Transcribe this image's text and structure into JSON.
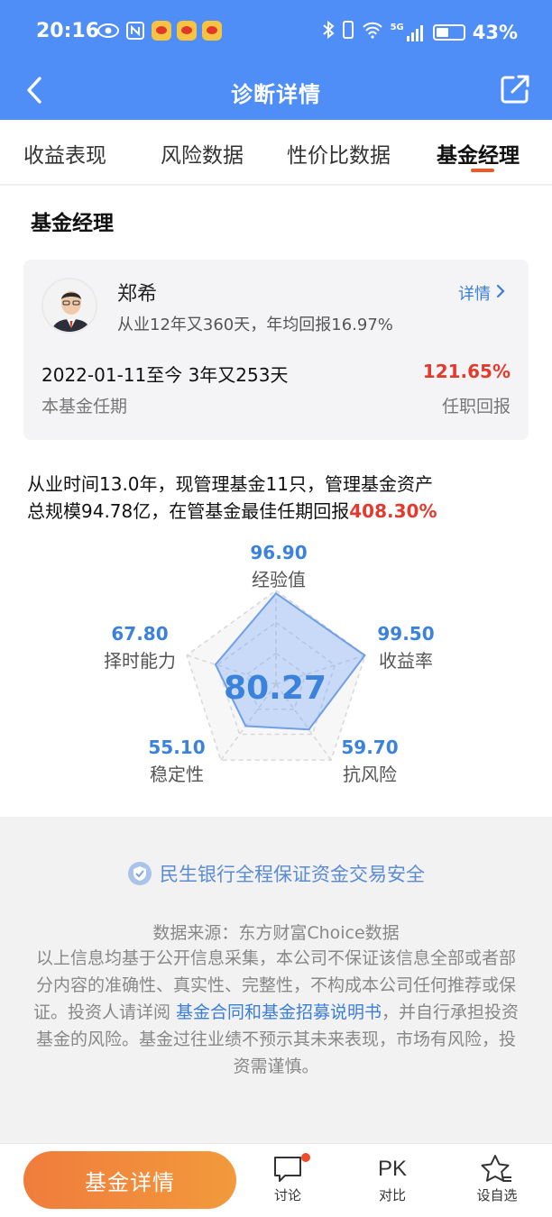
{
  "status_bar": {
    "time": "20:16",
    "network": "5G",
    "battery": "43%"
  },
  "header": {
    "title": "诊断详情"
  },
  "tabs": [
    {
      "label": "收益表现"
    },
    {
      "label": "风险数据"
    },
    {
      "label": "性价比数据"
    },
    {
      "label": "基金经理"
    }
  ],
  "section": {
    "title": "基金经理"
  },
  "manager": {
    "name": "郑希",
    "subtitle": "从业12年又360天，年均回报16.97%",
    "detail_link": "详情",
    "tenure": "2022-01-11至今 3年又253天",
    "tenure_label": "本基金任期",
    "return": "121.65%",
    "return_label": "任职回报"
  },
  "summary": {
    "line1": "从业时间13.0年，现管理基金11只，管理基金资产",
    "line2_prefix": "总规模94.78亿，在管基金最佳任期回报",
    "line2_highlight": "408.30%"
  },
  "radar": {
    "score": "80.27",
    "dimensions": [
      {
        "label": "经验值",
        "value": "96.90",
        "score": 96.9
      },
      {
        "label": "收益率",
        "value": "99.50",
        "score": 99.5
      },
      {
        "label": "抗风险",
        "value": "59.70",
        "score": 59.7
      },
      {
        "label": "稳定性",
        "value": "55.10",
        "score": 55.1
      },
      {
        "label": "择时能力",
        "value": "67.80",
        "score": 67.8
      }
    ]
  },
  "footer": {
    "guarantee": "民生银行全程保证资金交易安全",
    "source": "数据来源：东方财富Choice数据",
    "disclaimer_part1": "以上信息均基于公开信息采集，本公司不保证该信息全部或者部分内容的准确性、真实性、完整性，不构成本公司任何推荐或保证。投资人请详阅 ",
    "disclaimer_link": "基金合同和基金招募说明书",
    "disclaimer_part2": "，并自行承担投资基金的风险。基金过往业绩不预示其未来表现，市场有风险，投资需谨慎。"
  },
  "bottom_bar": {
    "primary_button": "基金详情",
    "nav": [
      {
        "label": "讨论",
        "icon": "chat-icon"
      },
      {
        "label": "对比",
        "icon": "pk-icon",
        "glyph": "PK"
      },
      {
        "label": "设自选",
        "icon": "star-list-icon"
      }
    ]
  },
  "colors": {
    "header_blue": "#4f8ef7",
    "accent_orange": "#f05a2a",
    "return_red": "#e23b2e",
    "radar_blue": "#3b82dc",
    "link_blue": "#3b7ddd"
  }
}
